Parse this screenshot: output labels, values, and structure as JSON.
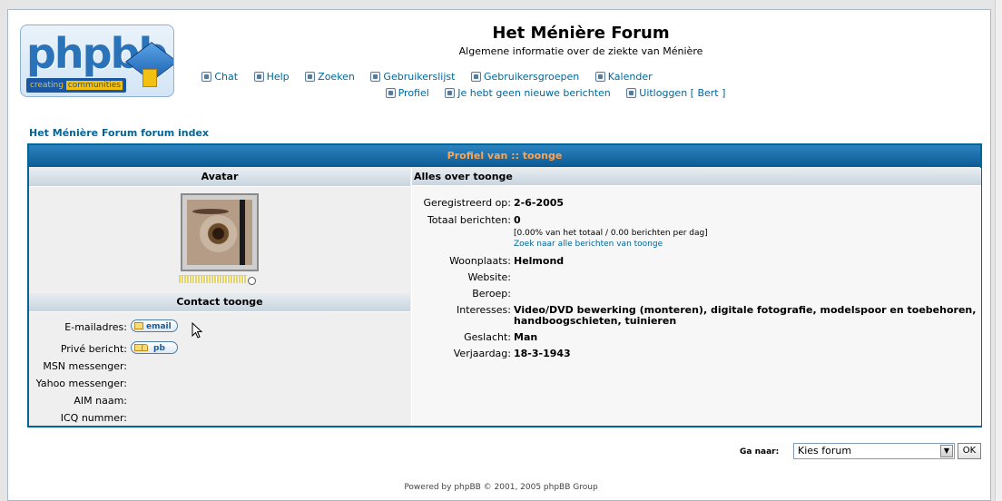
{
  "header": {
    "logo_word": "phpbb",
    "logo_tagline_a": "creating",
    "logo_tagline_b": "communities",
    "site_title": "Het Ménière Forum",
    "site_description": "Algemene informatie over de ziekte van Ménière"
  },
  "nav": {
    "row1": [
      {
        "label": "Chat",
        "icon": "chat-icon"
      },
      {
        "label": "Help",
        "icon": "help-icon"
      },
      {
        "label": "Zoeken",
        "icon": "search-icon"
      },
      {
        "label": "Gebruikerslijst",
        "icon": "memberlist-icon"
      },
      {
        "label": "Gebruikersgroepen",
        "icon": "groups-icon"
      },
      {
        "label": "Kalender",
        "icon": "calendar-icon"
      }
    ],
    "row2": [
      {
        "label": "Profiel",
        "icon": "profile-icon"
      },
      {
        "label": "Je hebt geen nieuwe berichten",
        "icon": "messages-icon"
      },
      {
        "label": "Uitloggen [ Bert ]",
        "icon": "logout-icon"
      }
    ]
  },
  "breadcrumb": "Het Ménière Forum forum index",
  "profile": {
    "title": "Profiel van :: toonge",
    "avatar_header": "Avatar",
    "about_header": "Alles over toonge",
    "contact_header": "Contact toonge",
    "contact": [
      {
        "label": "E-mailadres:",
        "button": "email"
      },
      {
        "label": "Privé bericht:",
        "button": "pb"
      },
      {
        "label": "MSN messenger:"
      },
      {
        "label": "Yahoo messenger:"
      },
      {
        "label": "AIM naam:"
      },
      {
        "label": "ICQ nummer:"
      }
    ],
    "info": {
      "registered_label": "Geregistreerd op:",
      "registered_value": "2-6-2005",
      "posts_label": "Totaal berichten:",
      "posts_value": "0",
      "posts_stats": "[0.00% van het totaal / 0.00 berichten per dag]",
      "posts_search_link": "Zoek naar alle berichten van toonge",
      "location_label": "Woonplaats:",
      "location_value": "Helmond",
      "website_label": "Website:",
      "occupation_label": "Beroep:",
      "interests_label": "Interesses:",
      "interests_line1": "Video/DVD bewerking (monteren), digitale fotografie, modelspoor en toebehoren,",
      "interests_line2": "handboogschieten, tuinieren",
      "gender_label": "Geslacht:",
      "gender_value": "Man",
      "birthday_label": "Verjaardag:",
      "birthday_value": "18-3-1943"
    }
  },
  "jump": {
    "label": "Ga naar:",
    "selected": "Kies forum",
    "ok": "OK"
  },
  "footer": "Powered by phpBB © 2001, 2005 phpBB Group"
}
